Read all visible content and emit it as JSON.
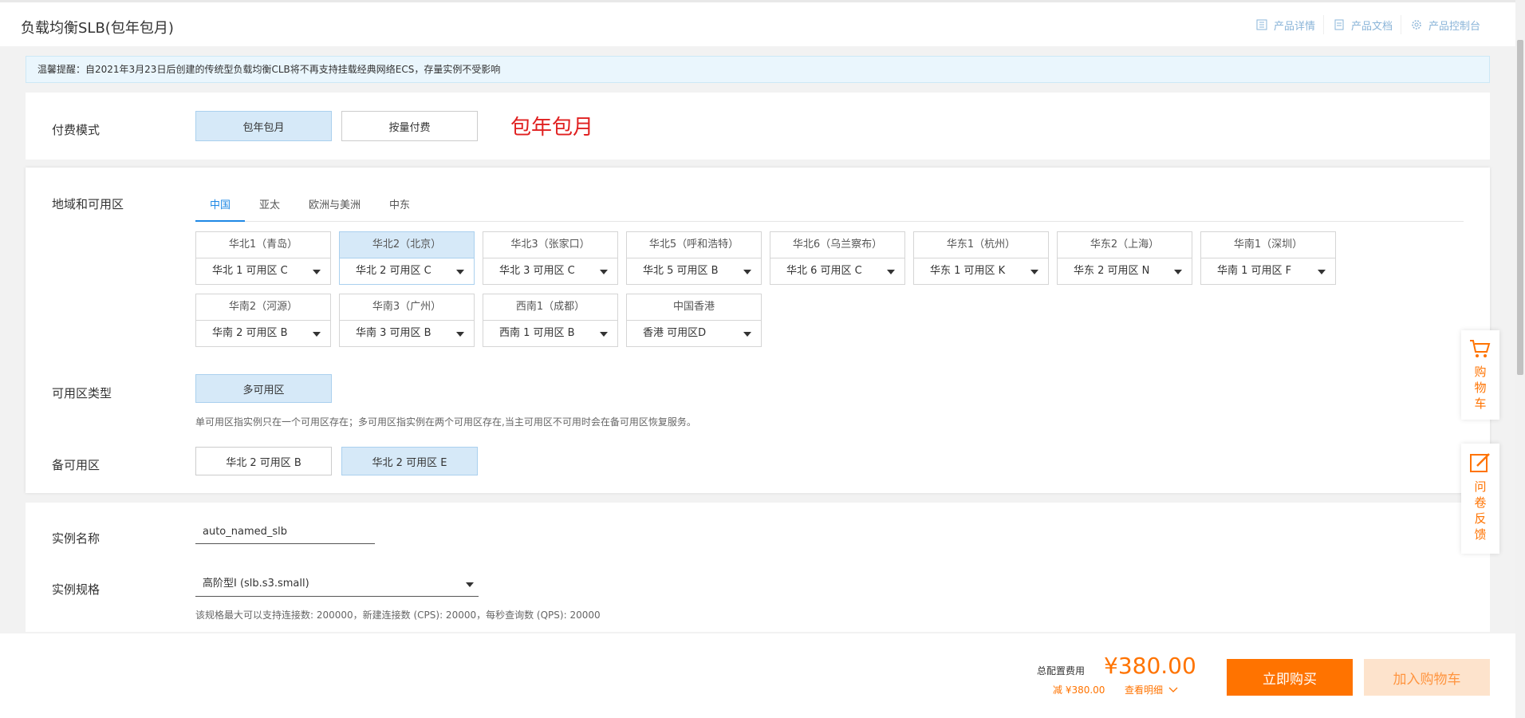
{
  "header": {
    "title": "负载均衡SLB(包年包月)",
    "links": [
      {
        "label": "产品详情",
        "icon": "list-icon"
      },
      {
        "label": "产品文档",
        "icon": "document-icon"
      },
      {
        "label": "产品控制台",
        "icon": "gear-icon"
      }
    ]
  },
  "notice": "温馨提醒：自2021年3月23日后创建的传统型负载均衡CLB将不再支持挂载经典网络ECS，存量实例不受影响",
  "payment": {
    "label": "付费模式",
    "options": [
      "包年包月",
      "按量付费"
    ],
    "selected": "包年包月",
    "highlight": "包年包月"
  },
  "region": {
    "label": "地域和可用区",
    "tabs": [
      "中国",
      "亚太",
      "欧洲与美洲",
      "中东"
    ],
    "active_tab": "中国",
    "items": [
      {
        "name": "华北1（青岛）",
        "zone": "华北 1 可用区 C"
      },
      {
        "name": "华北2（北京）",
        "zone": "华北 2 可用区 C",
        "selected": true
      },
      {
        "name": "华北3（张家口）",
        "zone": "华北 3 可用区 C"
      },
      {
        "name": "华北5（呼和浩特）",
        "zone": "华北 5 可用区 B"
      },
      {
        "name": "华北6（乌兰察布）",
        "zone": "华北 6 可用区 C"
      },
      {
        "name": "华东1（杭州）",
        "zone": "华东 1 可用区 K"
      },
      {
        "name": "华东2（上海）",
        "zone": "华东 2 可用区 N"
      },
      {
        "name": "华南1（深圳）",
        "zone": "华南 1 可用区 F"
      },
      {
        "name": "华南2（河源）",
        "zone": "华南 2 可用区 B"
      },
      {
        "name": "华南3（广州）",
        "zone": "华南 3 可用区 B"
      },
      {
        "name": "西南1（成都）",
        "zone": "西南 1 可用区 B"
      },
      {
        "name": "中国香港",
        "zone": "香港 可用区D"
      }
    ]
  },
  "zone_type": {
    "label": "可用区类型",
    "option": "多可用区",
    "help": "单可用区指实例只在一个可用区存在；多可用区指实例在两个可用区存在,当主可用区不可用时会在备可用区恢复服务。"
  },
  "backup_zone": {
    "label": "备可用区",
    "options": [
      "华北 2 可用区 B",
      "华北 2 可用区 E"
    ],
    "selected": "华北 2 可用区 E"
  },
  "instance_name": {
    "label": "实例名称",
    "value": "auto_named_slb"
  },
  "instance_spec": {
    "label": "实例规格",
    "value": "高阶型I (slb.s3.small)",
    "help": "该规格最大可以支持连接数: 200000，新建连接数 (CPS): 20000，每秒查询数 (QPS): 20000"
  },
  "footer": {
    "total_label": "总配置费用",
    "price": "¥380.00",
    "discount": "减 ¥380.00",
    "detail": "查看明细",
    "buy": "立即购买",
    "add_cart": "加入购物车"
  },
  "sidebar": {
    "cart": "购物车",
    "feedback": "问卷反馈"
  },
  "colors": {
    "accent_blue": "#1e88e5",
    "selected_bg": "#d6e9f8",
    "orange": "#ff7300",
    "red": "#e02020"
  }
}
